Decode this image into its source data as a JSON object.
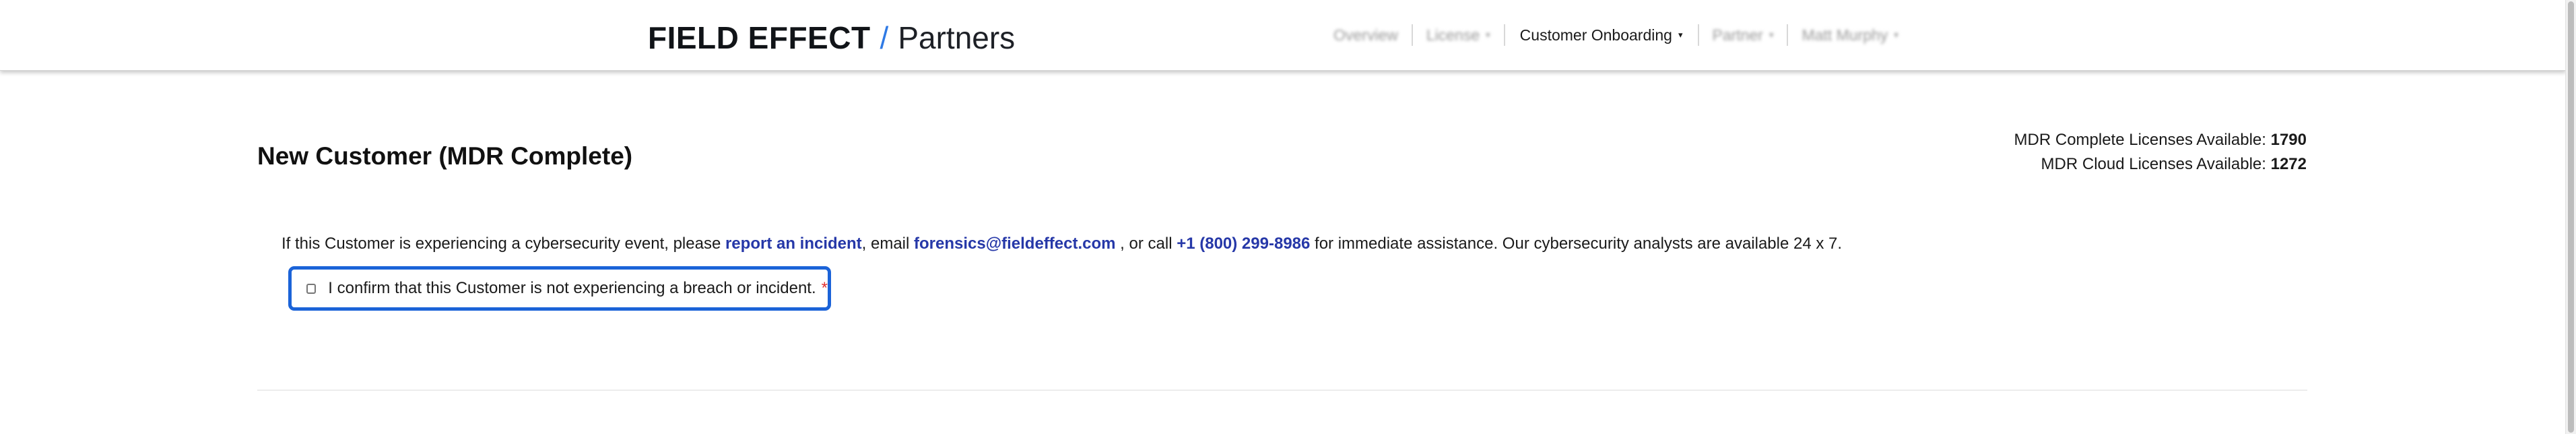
{
  "header": {
    "brand_main": "FIELD EFFECT",
    "brand_slash": "/",
    "brand_sub": "Partners",
    "nav": [
      {
        "label": "Overview",
        "has_caret": false,
        "active": false
      },
      {
        "label": "License",
        "has_caret": true,
        "active": false
      },
      {
        "label": "Customer Onboarding",
        "has_caret": true,
        "active": true
      },
      {
        "label": "Partner",
        "has_caret": true,
        "active": false
      },
      {
        "label": "Matt Murphy",
        "has_caret": true,
        "active": false
      }
    ],
    "caret_glyph": "▾"
  },
  "main": {
    "title": "New Customer (MDR Complete)",
    "licenses": {
      "complete_label": "MDR Complete Licenses Available:",
      "complete_value": "1790",
      "cloud_label": "MDR Cloud Licenses Available:",
      "cloud_value": "1272"
    },
    "notice": {
      "text_1": "If this Customer is experiencing a cybersecurity event, please ",
      "link_report": "report an incident",
      "text_2": ", email ",
      "link_email": "forensics@fieldeffect.com",
      "text_3": " , or call ",
      "link_phone": "+1 (800) 299-8986",
      "text_4": " for immediate assistance. Our cybersecurity analysts are available 24 x 7."
    },
    "confirm": {
      "label": "I confirm that this Customer is not experiencing a breach or incident.",
      "required_mark": "*",
      "checked": false
    }
  },
  "colors": {
    "link": "#2638a8",
    "brand_slash": "#2f7ae5",
    "focus_border": "#1b63d8",
    "required": "#e03131"
  }
}
